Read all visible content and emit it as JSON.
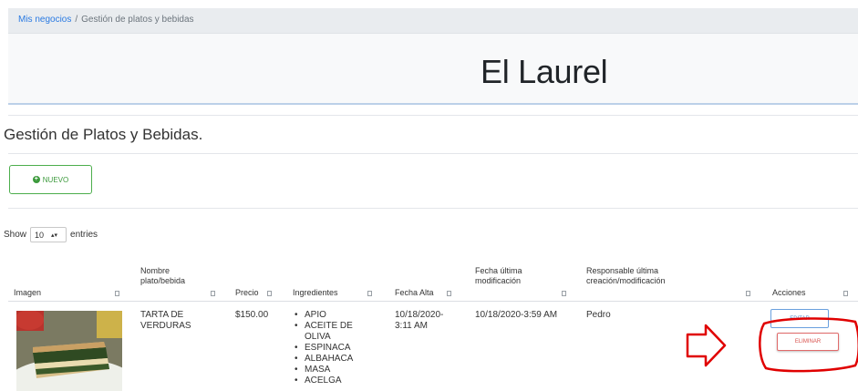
{
  "breadcrumb": {
    "link": "Mis negocios",
    "separator": "/",
    "current": "Gestión de platos y bebidas"
  },
  "hero": {
    "title": "El Laurel"
  },
  "page": {
    "heading": "Gestión de Platos y Bebidas."
  },
  "toolbar": {
    "new_label": "NUEVO",
    "new_icon": "plus-circle-icon"
  },
  "entries": {
    "show_label": "Show",
    "selected": "10",
    "suffix": "entries"
  },
  "table": {
    "columns": [
      "Imagen",
      "Nombre plato/bebida",
      "Precio",
      "Ingredientes",
      "Fecha Alta",
      "Fecha última modificación",
      "Responsable última creación/modificación",
      "Acciones"
    ],
    "rows": [
      {
        "image": "food-photo",
        "name": "TARTA DE VERDURAS",
        "price": "$150.00",
        "ingredients": [
          "APIO",
          "ACEITE DE OLIVA",
          "ESPINACA",
          "ALBAHACA",
          "MASA",
          "ACELGA"
        ],
        "created": "10/18/2020-3:11 AM",
        "modified": "10/18/2020-3:59 AM",
        "responsible": "Pedro",
        "edit_label": "EDITAR",
        "delete_label": "ELIMINAR"
      }
    ]
  },
  "colors": {
    "link": "#2a7ae2",
    "success": "#4cae4c",
    "primary": "#6aa0de",
    "danger": "#d9534f",
    "annotation": "#e00000"
  }
}
